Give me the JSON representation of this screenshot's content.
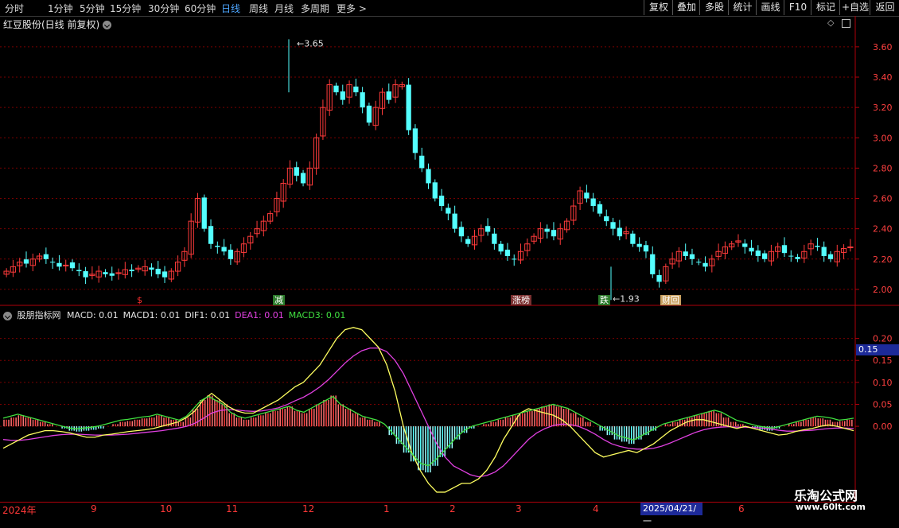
{
  "toolbar": {
    "tabs": [
      "分时",
      "1分钟",
      "5分钟",
      "15分钟",
      "30分钟",
      "60分钟",
      "日线",
      "周线",
      "月线",
      "多周期",
      "更多 >"
    ],
    "active_tab": "日线",
    "buttons": [
      "复权",
      "叠加",
      "多股",
      "统计",
      "画线",
      "F10",
      "标记",
      "+自选",
      "返回"
    ]
  },
  "chart_title": "红豆股份(日线 前复权)",
  "price_axis": [
    "3.60",
    "3.40",
    "3.20",
    "3.00",
    "2.80",
    "2.60",
    "2.40",
    "2.20",
    "2.00"
  ],
  "max_label": "3.65",
  "min_label": "1.93",
  "signals": [
    {
      "text": "$",
      "color": "#ff3030"
    },
    {
      "text": "减",
      "color": "#ffffff",
      "bg": "#2a7a2a"
    },
    {
      "text": "涨榜",
      "color": "#ffffff",
      "bg": "#7a3030"
    },
    {
      "text": "跌",
      "color": "#ffffff",
      "bg": "#2a7a2a"
    },
    {
      "text": "财回",
      "color": "#ffffff",
      "bg": "#c8a060"
    }
  ],
  "indicator": {
    "name": "股朋指标网",
    "items": [
      {
        "text": "MACD: 0.01",
        "color": "#e6e6e6"
      },
      {
        "text": "MACD1: 0.01",
        "color": "#e6e6e6"
      },
      {
        "text": "DIF1: 0.01",
        "color": "#e6e6e6"
      },
      {
        "text": "DEA1: 0.01",
        "color": "#e040e0"
      },
      {
        "text": "MACD3: 0.01",
        "color": "#40e040"
      }
    ],
    "axis": [
      "0.20",
      "0.15",
      "0.10",
      "0.05",
      "0.00"
    ],
    "cursor_value": "0.15"
  },
  "x_axis": [
    "2024年",
    "9",
    "10",
    "11",
    "12",
    "1",
    "2",
    "3",
    "4",
    "6"
  ],
  "cursor_date": "2025/04/21/一",
  "watermark": {
    "name": "乐淘公式网",
    "url": "www.60lt.com"
  },
  "colors": {
    "up": "#ff3b3b",
    "down": "#54ffff",
    "grid": "#7a0000",
    "axis": "#b0000a",
    "active": "#4da6ff"
  },
  "chart_data": {
    "type": "candlestick",
    "title": "红豆股份(日线 前复权)",
    "ylim": [
      1.9,
      3.72
    ],
    "high": 3.65,
    "low": 1.93,
    "close": [
      2.12,
      2.15,
      2.18,
      2.17,
      2.2,
      2.22,
      2.2,
      2.18,
      2.15,
      2.16,
      2.14,
      2.12,
      2.08,
      2.1,
      2.12,
      2.1,
      2.09,
      2.11,
      2.13,
      2.12,
      2.14,
      2.15,
      2.13,
      2.1,
      2.08,
      2.12,
      2.18,
      2.25,
      2.45,
      2.6,
      2.4,
      2.3,
      2.28,
      2.25,
      2.2,
      2.25,
      2.3,
      2.35,
      2.4,
      2.45,
      2.5,
      2.6,
      2.7,
      2.8,
      2.75,
      2.7,
      2.8,
      3.0,
      3.2,
      3.35,
      3.3,
      3.25,
      3.35,
      3.3,
      3.2,
      3.1,
      3.2,
      3.3,
      3.25,
      3.35,
      3.35,
      3.05,
      2.9,
      2.8,
      2.7,
      2.6,
      2.55,
      2.5,
      2.4,
      2.35,
      2.3,
      2.35,
      2.4,
      2.38,
      2.3,
      2.25,
      2.22,
      2.2,
      2.25,
      2.3,
      2.35,
      2.4,
      2.38,
      2.35,
      2.4,
      2.45,
      2.55,
      2.65,
      2.6,
      2.55,
      2.5,
      2.45,
      2.4,
      2.35,
      2.38,
      2.3,
      2.28,
      2.25,
      2.1,
      2.05,
      2.15,
      2.2,
      2.25,
      2.22,
      2.2,
      2.18,
      2.15,
      2.2,
      2.25,
      2.28,
      2.3,
      2.32,
      2.28,
      2.25,
      2.22,
      2.2,
      2.25,
      2.28,
      2.24,
      2.22,
      2.2,
      2.25,
      2.3,
      2.28,
      2.22,
      2.2,
      2.25,
      2.27,
      2.28
    ],
    "macd_hist": [
      0.015,
      0.02,
      0.025,
      0.02,
      0.015,
      0.01,
      0.005,
      0.0,
      -0.005,
      -0.01,
      -0.012,
      -0.01,
      -0.008,
      -0.005,
      0.0,
      0.005,
      0.01,
      0.012,
      0.015,
      0.018,
      0.02,
      0.025,
      0.02,
      0.015,
      0.01,
      0.02,
      0.04,
      0.06,
      0.07,
      0.06,
      0.05,
      0.03,
      0.02,
      0.015,
      0.02,
      0.025,
      0.03,
      0.035,
      0.04,
      0.045,
      0.035,
      0.03,
      0.04,
      0.05,
      0.06,
      0.07,
      0.05,
      0.04,
      0.03,
      0.02,
      0.015,
      0.01,
      0.0,
      -0.02,
      -0.04,
      -0.06,
      -0.08,
      -0.1,
      -0.105,
      -0.09,
      -0.07,
      -0.05,
      -0.03,
      -0.015,
      -0.005,
      0.0,
      0.005,
      0.01,
      0.015,
      0.02,
      0.025,
      0.03,
      0.035,
      0.04,
      0.045,
      0.05,
      0.045,
      0.04,
      0.03,
      0.02,
      0.01,
      0.0,
      -0.01,
      -0.02,
      -0.03,
      -0.035,
      -0.04,
      -0.03,
      -0.02,
      -0.01,
      0.0,
      0.005,
      0.01,
      0.015,
      0.02,
      0.025,
      0.03,
      0.035,
      0.03,
      0.02,
      0.01,
      0.005,
      0.0,
      -0.005,
      -0.008,
      -0.01,
      -0.005,
      0.0,
      0.005,
      0.01,
      0.015,
      0.02,
      0.018,
      0.015,
      0.01,
      0.012,
      0.015
    ],
    "dif": [
      -0.05,
      -0.04,
      -0.03,
      -0.02,
      -0.015,
      -0.01,
      -0.01,
      -0.012,
      -0.015,
      -0.02,
      -0.025,
      -0.025,
      -0.02,
      -0.018,
      -0.015,
      -0.012,
      -0.01,
      -0.008,
      -0.005,
      0.0,
      0.005,
      0.01,
      0.02,
      0.035,
      0.06,
      0.075,
      0.06,
      0.045,
      0.035,
      0.03,
      0.03,
      0.04,
      0.05,
      0.06,
      0.075,
      0.09,
      0.1,
      0.12,
      0.14,
      0.17,
      0.2,
      0.22,
      0.225,
      0.22,
      0.2,
      0.18,
      0.14,
      0.08,
      0.0,
      -0.06,
      -0.1,
      -0.13,
      -0.15,
      -0.15,
      -0.14,
      -0.13,
      -0.13,
      -0.12,
      -0.1,
      -0.07,
      -0.03,
      0.0,
      0.03,
      0.04,
      0.035,
      0.03,
      0.025,
      0.015,
      0.0,
      -0.02,
      -0.04,
      -0.06,
      -0.07,
      -0.065,
      -0.06,
      -0.055,
      -0.06,
      -0.05,
      -0.04,
      -0.025,
      -0.01,
      0.0,
      0.01,
      0.015,
      0.015,
      0.01,
      0.005,
      0.0,
      -0.005,
      0.0,
      -0.005,
      -0.01,
      -0.015,
      -0.02,
      -0.018,
      -0.012,
      -0.008,
      -0.005,
      0.0,
      0.003,
      0.0,
      -0.005,
      -0.01
    ],
    "dea": [
      -0.03,
      -0.032,
      -0.032,
      -0.03,
      -0.027,
      -0.024,
      -0.021,
      -0.019,
      -0.018,
      -0.018,
      -0.019,
      -0.02,
      -0.02,
      -0.02,
      -0.019,
      -0.018,
      -0.016,
      -0.014,
      -0.012,
      -0.01,
      -0.007,
      -0.004,
      0.0,
      0.007,
      0.018,
      0.03,
      0.036,
      0.038,
      0.037,
      0.035,
      0.034,
      0.035,
      0.038,
      0.042,
      0.049,
      0.058,
      0.066,
      0.077,
      0.09,
      0.106,
      0.125,
      0.144,
      0.16,
      0.172,
      0.178,
      0.178,
      0.17,
      0.15,
      0.12,
      0.08,
      0.04,
      0.0,
      -0.04,
      -0.07,
      -0.09,
      -0.1,
      -0.11,
      -0.115,
      -0.112,
      -0.104,
      -0.09,
      -0.07,
      -0.05,
      -0.03,
      -0.015,
      -0.005,
      0.002,
      0.005,
      0.004,
      0.0,
      -0.008,
      -0.018,
      -0.03,
      -0.04,
      -0.046,
      -0.05,
      -0.052,
      -0.052,
      -0.05,
      -0.045,
      -0.038,
      -0.03,
      -0.022,
      -0.014,
      -0.008,
      -0.004,
      -0.002,
      -0.001,
      -0.002,
      -0.002,
      -0.003,
      -0.004,
      -0.006,
      -0.009,
      -0.011,
      -0.011,
      -0.01,
      -0.009,
      -0.007,
      -0.005,
      -0.004,
      -0.004,
      -0.005
    ]
  }
}
